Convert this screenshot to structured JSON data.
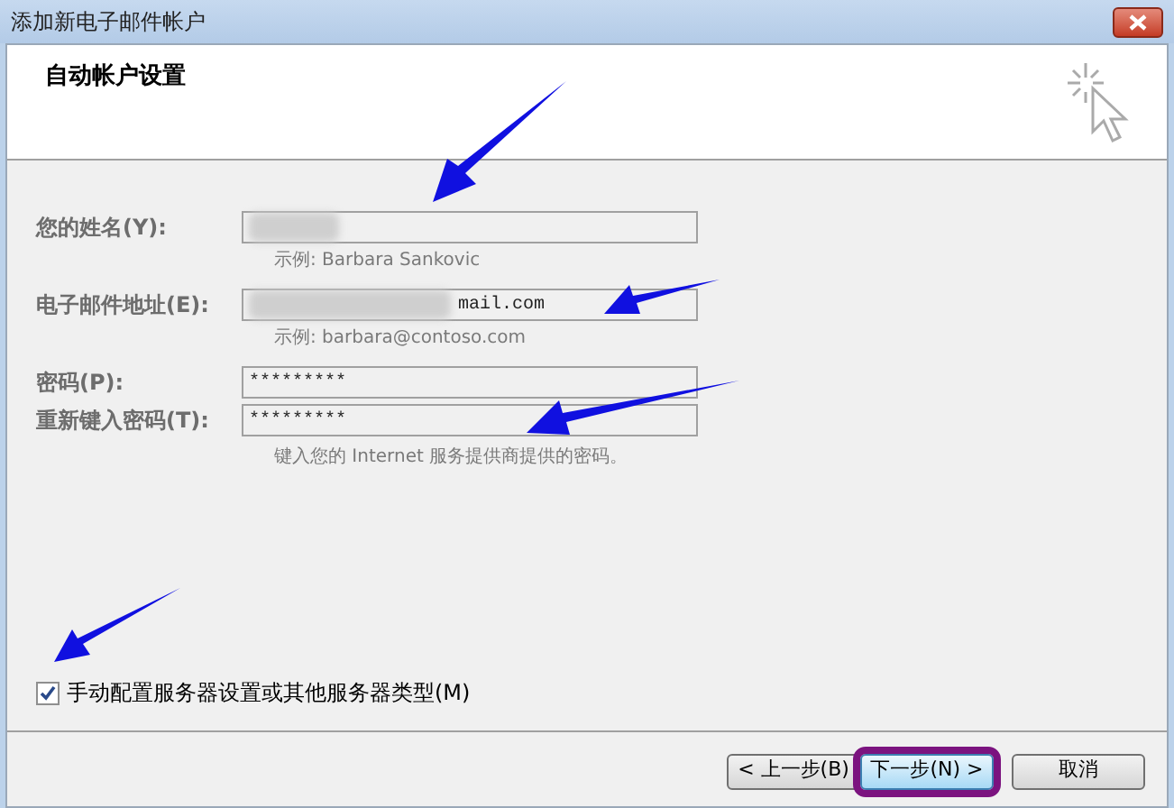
{
  "window": {
    "title": "添加新电子邮件帐户"
  },
  "header": {
    "title": "自动帐户设置"
  },
  "fields": [
    {
      "kind": "blurred",
      "label": "您的姓名(Y):",
      "hint": "示例: Barbara Sankovic"
    },
    {
      "kind": "blurred",
      "label": "电子邮件地址(E):",
      "value": "mail.com",
      "hint": "示例: barbara@contoso.com"
    },
    {
      "kind": "password",
      "label": "密码(P):",
      "value": "*********"
    },
    {
      "kind": "password",
      "label": "重新键入密码(T):",
      "value": "*********",
      "hint": "键入您的 Internet 服务提供商提供的密码。"
    }
  ],
  "manual_setup": {
    "label": "手动配置服务器设置或其他服务器类型(M)",
    "checked": true
  },
  "buttons": [
    {
      "label": "< 上一步(B)",
      "highlighted": false
    },
    {
      "label": "下一步(N) >",
      "highlighted": true
    },
    {
      "label": "取消",
      "highlighted": false
    }
  ]
}
